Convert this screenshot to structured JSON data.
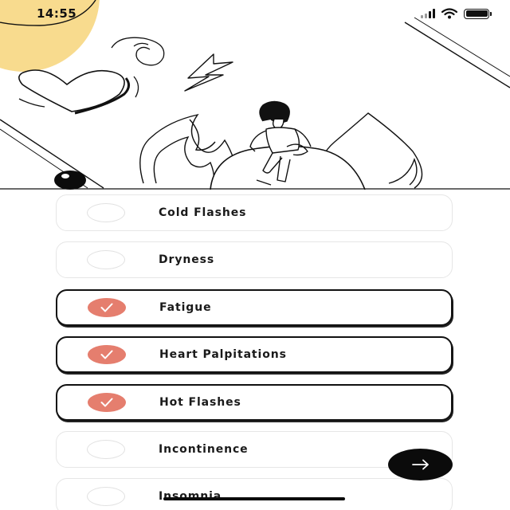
{
  "status_bar": {
    "time": "14:55",
    "icons": [
      "signal-icon",
      "wifi-icon",
      "battery-icon"
    ]
  },
  "hero": {
    "illustration": "woman-sitting-on-sphere-illustration",
    "accent_color": "#f8db8e",
    "elements": [
      "heart-icon",
      "lightning-icon",
      "swirl-icon",
      "flame-icon",
      "water-drop-icon"
    ]
  },
  "symptoms": {
    "selected_color": "#e57e6e",
    "items": [
      {
        "label": "Cold Flashes",
        "selected": false
      },
      {
        "label": "Dryness",
        "selected": false
      },
      {
        "label": "Fatigue",
        "selected": true
      },
      {
        "label": "Heart Palpitations",
        "selected": true
      },
      {
        "label": "Hot Flashes",
        "selected": true
      },
      {
        "label": "Incontinence",
        "selected": false
      },
      {
        "label": "Insomnia",
        "selected": false
      }
    ]
  },
  "next_button": {
    "icon": "arrow-right-icon"
  }
}
